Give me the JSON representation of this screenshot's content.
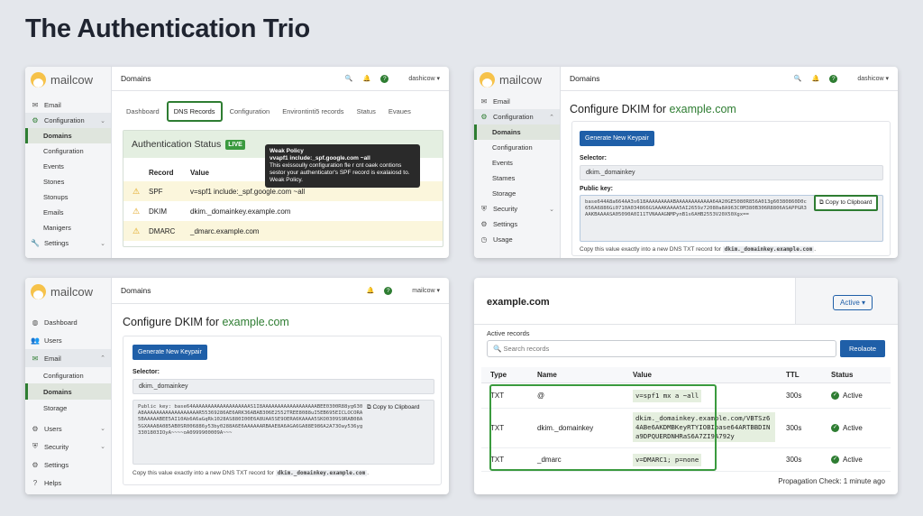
{
  "title": "The Authentication Trio",
  "colors": {
    "accent_green": "#2e7d32",
    "primary_blue": "#1f5fa8",
    "warning": "#e0a010"
  },
  "panel1": {
    "logo": "mailcow",
    "header": "Domains",
    "user": "dashicow",
    "sidebar": {
      "email": "Email",
      "configuration": "Configuration",
      "domains": "Domains",
      "configuration_sub": "Configuration",
      "events": "Events",
      "stones": "Stones",
      "stonups": "Stonups",
      "emails": "Emails",
      "manigers": "Manigers",
      "settings": "Settings"
    },
    "tabs": [
      "Dashboard",
      "DNS Records",
      "Configuration",
      "Environtinti5 records",
      "Status",
      "Evaues"
    ],
    "auth_title": "Authentication Status",
    "live_badge": "LIVE",
    "col_record": "Record",
    "col_value": "Value",
    "rows": [
      {
        "record": "SPF",
        "value": "v=spf1 include:_spf.google.com ~all"
      },
      {
        "record": "DKIM",
        "value": "dkim._domainkey.example.com"
      },
      {
        "record": "DMARC",
        "value": "_dmarc.example.com"
      }
    ],
    "tooltip": {
      "title": "Weak Policy",
      "line1": "vvapf1 include:_spf.google.com ~all",
      "body": "This exissoully configuration fle r cnt oaek contions sestor your authenticator's SPF record is exalaiosd to. Weak Policy."
    }
  },
  "panel2": {
    "logo": "mailcow",
    "header": "Domains",
    "user": "dashicow",
    "sidebar": {
      "email": "Email",
      "configuration": "Configuration",
      "domains": "Domains",
      "configuration_sub": "Configuration",
      "events": "Events",
      "stames": "Stames",
      "storage": "Storage",
      "security": "Security",
      "settings": "Settings",
      "usage": "Usage"
    },
    "title_prefix": "Configure DKIM for",
    "domain": "example.com",
    "generate_button": "Generate New Keypair",
    "selector_label": "Selector:",
    "selector_value": "dkim._domainkey",
    "public_key_label": "Public key:",
    "public_key": "base644A8a664AA3s618AAAAAAAAABAAAAAAAAAAAA64A20GE5080R856A013g60380860D0c656A6886Gi0710A034866GSAAAKAAAA5AI2659z72080a8A963C0M380B306R8806ASAPPGR3AAKBAAAASA05090A0I11TVNAAAGNMPynB1s6AHB2553V20X50Xgx==",
    "copy_button": "Copy to Clipboard",
    "note_prefix": "Copy this value exactly into a new DNS TXT record for",
    "note_code": "dkim._domainkey.example.com"
  },
  "panel3": {
    "logo": "mailcow",
    "header": "Domains",
    "user": "mailcow",
    "sidebar": {
      "dashboard": "Dashboard",
      "users": "Users",
      "email": "Email",
      "configuration": "Configuration",
      "domains": "Domains",
      "storage": "Storage",
      "users2": "Users",
      "security": "Security",
      "settings": "Settings",
      "helps": "Helps"
    },
    "title_prefix": "Configure DKIM for",
    "domain": "example.com",
    "generate_button": "Generate New Keypair",
    "selector_label": "Selector:",
    "selector_value": "dkim._domainkey",
    "public_key": "Public key: base64AAAAAAAAAAAAAAAAAAAS1I8AAAAAAAAAAAAAAAAAABEE0300R88yg630A8AAAAAAAAAAAAAAAAAAR55369286AE6ARK36ABAB306E2552TREE8088uI5EB695EICLOCORA5BAAAAABEE5AI10Ab6A6aGqRk1028AS880I00E6A8UAA5SE9OERA6KAAAA5SKO0309S9RAB08A5GXAAA8A085AB0SR006886y53by0288A6E6AAAAAARBAAE8A6AGA6GA88E986A2A73Oay536yg3301803IOyA~~~~oA0999900009A~~~",
    "copy_button": "Copy to Clipboard",
    "note_prefix": "Copy this value exactly into a new DNS TXT record for",
    "note_code": "dkim._domainkey.example.com"
  },
  "panel4": {
    "domain": "example.com",
    "active_select": "Active",
    "active_records_label": "Active records",
    "search_placeholder": "Search records",
    "reload_button": "Reolaote",
    "columns": [
      "Type",
      "Name",
      "Value",
      "TTL",
      "Status"
    ],
    "rows": [
      {
        "type": "TXT",
        "name": "@",
        "value": "v=spf1 mx a ~all",
        "ttl": "300s",
        "status": "Active"
      },
      {
        "type": "TXT",
        "name": "dkim._domainkey",
        "value": "dkim._domainkey.example.com/VBTSz64ABe6AKDMBKeyRTYIOBIbase64ARTBBDINa9DPQUERDNHRaS6A7ZI9A792y",
        "ttl": "300s",
        "status": "Active"
      },
      {
        "type": "TXT",
        "name": "_dmarc",
        "value": "v=DMARC1; p=none",
        "ttl": "300s",
        "status": "Active"
      }
    ],
    "propagation": "Propagation Check: 1 minute ago"
  }
}
